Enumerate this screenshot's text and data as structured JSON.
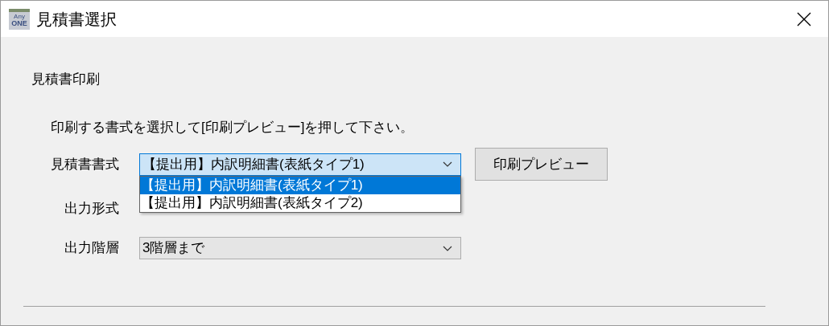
{
  "window": {
    "title": "見積書選択",
    "logo": [
      "Any",
      "ONE"
    ]
  },
  "section_title": "見積書印刷",
  "instruction": "印刷する書式を選択して[印刷プレビュー]を押して下さい。",
  "format_field": {
    "label": "見積書書式",
    "value": "【提出用】内訳明細書(表紙タイプ1)",
    "expanded": true,
    "options": [
      {
        "label": "【提出用】内訳明細書(表紙タイプ1)",
        "selected": true
      },
      {
        "label": "【提出用】内訳明細書(表紙タイプ2)",
        "selected": false
      }
    ]
  },
  "preview_button": "印刷プレビュー",
  "output_format_field": {
    "label": "出力形式"
  },
  "output_level_field": {
    "label": "出力階層",
    "value": "3階層まで",
    "expanded": false
  }
}
